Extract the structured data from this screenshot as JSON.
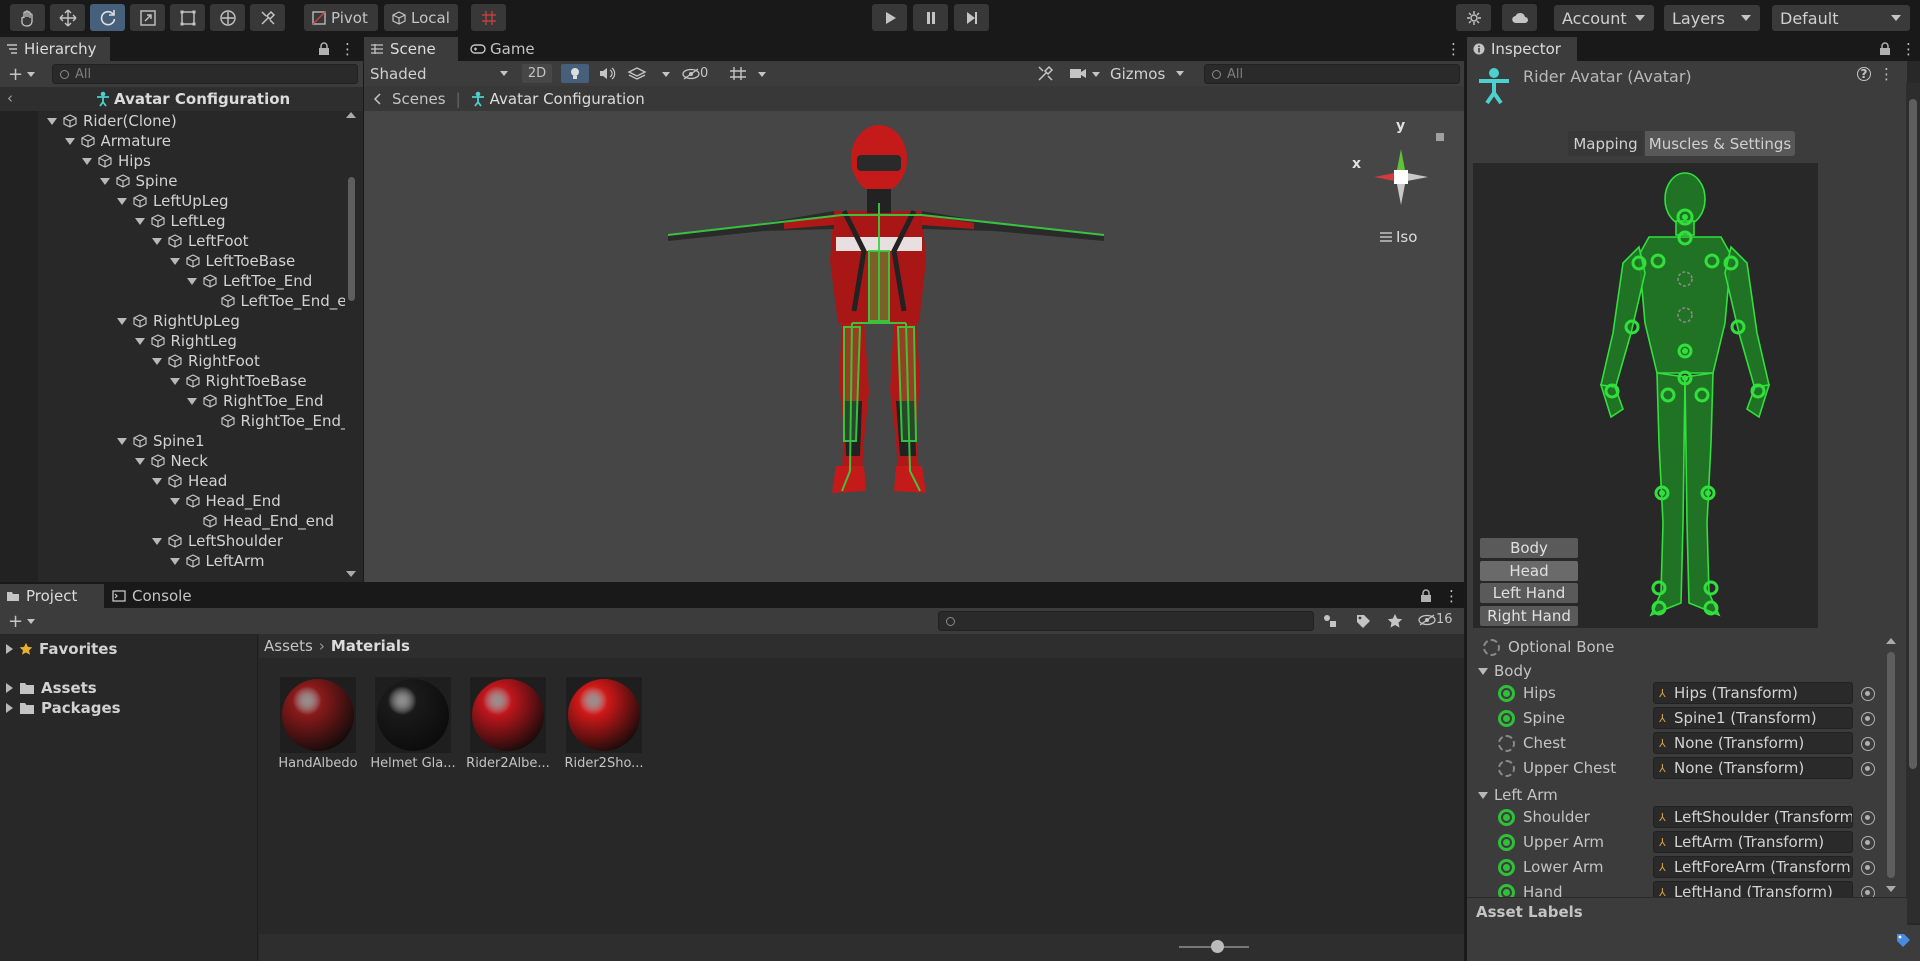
{
  "toolbar": {
    "tools": [
      "hand-tool",
      "move-tool",
      "rotate-tool",
      "scale-tool",
      "rect-tool",
      "transform-tool",
      "custom-tool"
    ],
    "pivot_label": "Pivot",
    "local_label": "Local",
    "account_label": "Account",
    "layers_label": "Layers",
    "layout_label": "Default"
  },
  "hierarchy": {
    "tab_label": "Hierarchy",
    "search_placeholder": "All",
    "context_title": "Avatar Configuration",
    "rows": [
      {
        "label": "Rider(Clone)",
        "expanded": true
      },
      {
        "label": "Armature",
        "expanded": true
      },
      {
        "label": "Hips",
        "expanded": true
      },
      {
        "label": "Spine",
        "expanded": true
      },
      {
        "label": "LeftUpLeg",
        "expanded": true
      },
      {
        "label": "LeftLeg",
        "expanded": true
      },
      {
        "label": "LeftFoot",
        "expanded": true
      },
      {
        "label": "LeftToeBase",
        "expanded": true
      },
      {
        "label": "LeftToe_End",
        "expanded": true
      },
      {
        "label": "LeftToe_End_er",
        "expanded": false
      },
      {
        "label": "RightUpLeg",
        "expanded": true
      },
      {
        "label": "RightLeg",
        "expanded": true
      },
      {
        "label": "RightFoot",
        "expanded": true
      },
      {
        "label": "RightToeBase",
        "expanded": true
      },
      {
        "label": "RightToe_End",
        "expanded": true
      },
      {
        "label": "RightToe_End_e",
        "expanded": false
      },
      {
        "label": "Spine1",
        "expanded": true
      },
      {
        "label": "Neck",
        "expanded": true
      },
      {
        "label": "Head",
        "expanded": true
      },
      {
        "label": "Head_End",
        "expanded": true
      },
      {
        "label": "Head_End_end",
        "expanded": false
      },
      {
        "label": "LeftShoulder",
        "expanded": true
      },
      {
        "label": "LeftArm",
        "expanded": true
      }
    ]
  },
  "scene": {
    "tab_scene": "Scene",
    "tab_game": "Game",
    "shading_mode": "Shaded",
    "mode_2d": "2D",
    "hidden_count": "0",
    "gizmos_label": "Gizmos",
    "search_placeholder": "All",
    "breadcrumb_root": "Scenes",
    "breadcrumb_current": "Avatar Configuration",
    "axis_x": "x",
    "axis_y": "y",
    "projection_label": "Iso"
  },
  "project": {
    "tab_project": "Project",
    "tab_console": "Console",
    "hidden_count": "16",
    "favorites_label": "Favorites",
    "tree": [
      "Assets",
      "Packages"
    ],
    "breadcrumb_root": "Assets",
    "breadcrumb_current": "Materials",
    "materials": [
      {
        "label": "HandAlbedo",
        "color": "#8a1a1a"
      },
      {
        "label": "Helmet Gla...",
        "color": "#1a1a1a"
      },
      {
        "label": "Rider2Albe...",
        "color": "#c0161c"
      },
      {
        "label": "Rider2Sho...",
        "color": "#d01818"
      }
    ]
  },
  "inspector": {
    "tab_label": "Inspector",
    "object_title": "Rider Avatar (Avatar)",
    "tab_mapping": "Mapping",
    "tab_muscles": "Muscles & Settings",
    "body_parts": [
      "Body",
      "Head",
      "Left Hand",
      "Right Hand"
    ],
    "optional_bone_label": "Optional Bone",
    "sections": [
      {
        "name": "Body",
        "bones": [
          {
            "label": "Hips",
            "value": "Hips (Transform)",
            "required": true
          },
          {
            "label": "Spine",
            "value": "Spine1 (Transform)",
            "required": true
          },
          {
            "label": "Chest",
            "value": "None (Transform)",
            "required": false
          },
          {
            "label": "Upper Chest",
            "value": "None (Transform)",
            "required": false
          }
        ]
      },
      {
        "name": "Left Arm",
        "bones": [
          {
            "label": "Shoulder",
            "value": "LeftShoulder (Transform)",
            "required": true
          },
          {
            "label": "Upper Arm",
            "value": "LeftArm (Transform)",
            "required": true
          },
          {
            "label": "Lower Arm",
            "value": "LeftForeArm (Transform)",
            "required": true
          },
          {
            "label": "Hand",
            "value": "LeftHand (Transform)",
            "required": true
          }
        ]
      }
    ],
    "asset_labels": "Asset Labels"
  },
  "colors": {
    "accent": "#46607c",
    "bone_green": "#2fbf3a",
    "rider_red": "#c0161c"
  }
}
